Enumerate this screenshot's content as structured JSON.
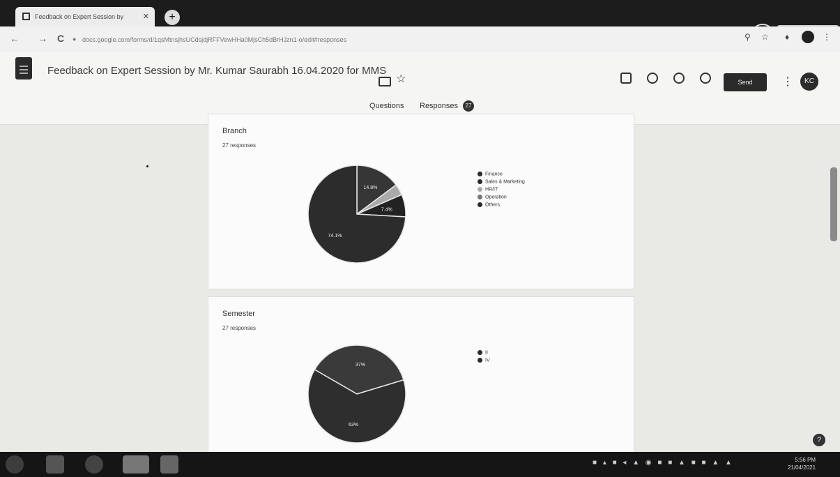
{
  "browser": {
    "tab_title": "Feedback on Expert Session by",
    "tab_close": "✕",
    "new_tab": "+",
    "nav_back": "←",
    "nav_forward": "→",
    "nav_reload": "C",
    "url": "docs.google.com/forms/d/1qsMtnsjhsUCdsjdjRFFVewHHa0MjsCh5dBrHJzn1-o/edit#responses"
  },
  "form": {
    "title": "Feedback on Expert Session by Mr. Kumar Saurabh 16.04.2020 for MMS",
    "send_label": "Send",
    "avatar_initials": "KC",
    "tabs": {
      "questions": "Questions",
      "responses": "Responses",
      "responses_count": "27"
    }
  },
  "cards": [
    {
      "title": "Branch",
      "count": "27 responses",
      "legend": [
        "Finance",
        "Sales & Marketing",
        "HR/IT",
        "Operation",
        "Others"
      ],
      "slices": [
        {
          "label": "Finance",
          "value": 74.1,
          "color": "#2c2c2c",
          "shown": "74.1%"
        },
        {
          "label": "Sales & Marketing",
          "value": 14.8,
          "color": "#363636",
          "shown": "14.8%"
        },
        {
          "label": "HR/IT",
          "value": 3.7,
          "color": "#aaaaaa",
          "shown": ""
        },
        {
          "label": "Operation",
          "value": 0,
          "color": "#777777",
          "shown": ""
        },
        {
          "label": "Others",
          "value": 7.4,
          "color": "#222222",
          "shown": "7.4%"
        }
      ]
    },
    {
      "title": "Semester",
      "count": "27 responses",
      "legend": [
        "II",
        "IV"
      ],
      "slices": [
        {
          "label": "II",
          "value": 63,
          "color": "#2e2e2e",
          "shown": "63%"
        },
        {
          "label": "IV",
          "value": 37,
          "color": "#3a3a3a",
          "shown": "37%"
        }
      ]
    }
  ],
  "taskbar": {
    "time": "5:56 PM",
    "date": "21/04/2021"
  },
  "help": "?"
}
